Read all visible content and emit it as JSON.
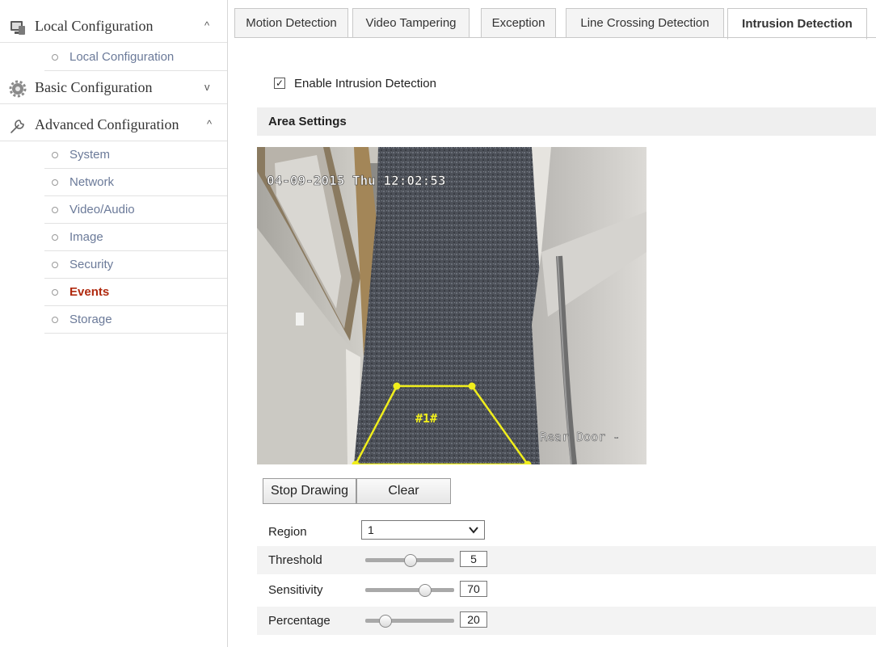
{
  "sidebar": {
    "sections": [
      {
        "title": "Local Configuration",
        "icon": "monitor-icon",
        "chevron": "^"
      },
      {
        "title": "Basic Configuration",
        "icon": "gear-icon",
        "chevron": "v"
      },
      {
        "title": "Advanced Configuration",
        "icon": "wrench-icon",
        "chevron": "^"
      }
    ],
    "local_items": [
      "Local Configuration"
    ],
    "advanced_items": [
      "System",
      "Network",
      "Video/Audio",
      "Image",
      "Security",
      "Events",
      "Storage"
    ],
    "active_item": "Events"
  },
  "tabs": [
    "Motion Detection",
    "Video Tampering",
    "Exception",
    "Line Crossing Detection",
    "Intrusion Detection"
  ],
  "active_tab": "Intrusion Detection",
  "enable": {
    "label": "Enable Intrusion Detection",
    "checked": true,
    "mark": "✓"
  },
  "area_settings": {
    "title": "Area Settings"
  },
  "video": {
    "timestamp": "04-09-2015 Thu 12:02:53",
    "region_label": "#1#",
    "camera_name": "Rear Door -",
    "overlay_color": "#f0ee1c"
  },
  "buttons": {
    "stop_drawing": "Stop Drawing",
    "clear": "Clear"
  },
  "region": {
    "label": "Region",
    "value": "1"
  },
  "threshold": {
    "label": "Threshold",
    "value": "5",
    "level": 0.5
  },
  "sensitivity": {
    "label": "Sensitivity",
    "value": "70",
    "level": 0.66
  },
  "percentage": {
    "label": "Percentage",
    "value": "20",
    "level": 0.22
  },
  "colors": {
    "active_item": "#b02a0f",
    "sidebar_item": "#6b7a99"
  }
}
